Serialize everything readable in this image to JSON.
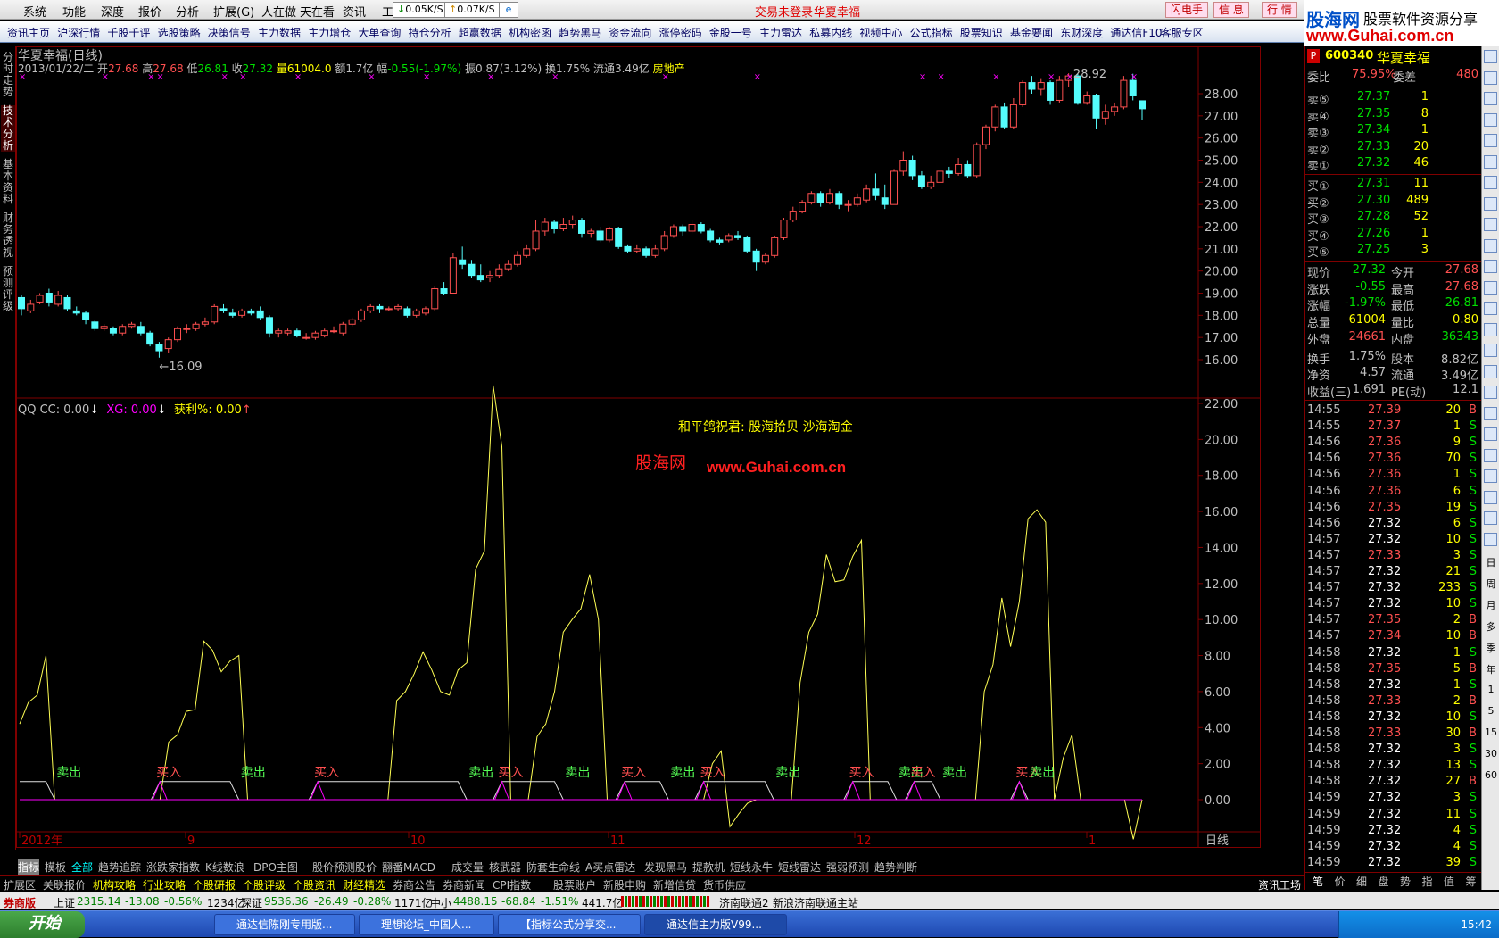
{
  "menu": {
    "items": [
      "系统",
      "功能",
      "深度",
      "报价",
      "分析",
      "扩展(G)",
      "人在做",
      "天在看",
      "资讯",
      "工"
    ],
    "net_down": "0.05K/S",
    "net_up": "0.07K/S",
    "status_login": "交易未登录",
    "stock_name": "华夏幸福",
    "btn_flash": "闪电手",
    "btn_info": "信 息",
    "btn_quote": "行 情"
  },
  "logo": {
    "name": "股海网",
    "slogan": "股票软件资源分享",
    "url": "www.Guhai.com.cn"
  },
  "toolbar": [
    "资讯主页",
    "沪深行情",
    "千股千评",
    "选股策略",
    "决策信号",
    "主力数据",
    "主力增仓",
    "大单查询",
    "持仓分析",
    "超赢数据",
    "机构密函",
    "趋势黑马",
    "资金流向",
    "涨停密码",
    "金股一号",
    "主力雷达",
    "私募内线",
    "视频中心",
    "公式指标",
    "股票知识",
    "基金要闻",
    "东财深度",
    "通达信F10",
    "客服专区"
  ],
  "side_tabs": [
    "分时走势",
    "技术分析",
    "基本资料",
    "财务透视",
    "预测评级"
  ],
  "chart": {
    "title": "华夏幸福(日线)",
    "date": "2013/01/22/二",
    "open_label": "开",
    "open": "27.68",
    "high_label": "高",
    "high": "27.68",
    "low_label": "低",
    "low": "26.81",
    "close_label": "收",
    "close": "27.32",
    "vol_label": "量",
    "vol": "61004.0",
    "amt_label": "额",
    "amt": "1.7亿",
    "chg_label": "幅",
    "chg": "-0.55(-1.97%)",
    "amp_label": "振",
    "amp": "0.87(3.12%)",
    "turn_label": "换",
    "turn": "1.75%",
    "float_label": "流通",
    "float": "3.49亿",
    "sector": "房地产",
    "max_label": "28.92",
    "min_label": "←16.09",
    "price_axis": [
      "28.00",
      "27.00",
      "26.00",
      "25.00",
      "24.00",
      "23.00",
      "22.00",
      "21.00",
      "20.00",
      "19.00",
      "18.00",
      "17.00",
      "16.00"
    ],
    "time_axis": [
      "2012年",
      "9",
      "10",
      "11",
      "12",
      "1"
    ],
    "period": "日线",
    "candles": [
      [
        18.8,
        18.3,
        18.9,
        18.0
      ],
      [
        18.2,
        18.5,
        18.7,
        18.1
      ],
      [
        18.6,
        18.9,
        19.0,
        18.5
      ],
      [
        19.0,
        18.6,
        19.2,
        18.4
      ],
      [
        18.5,
        18.9,
        19.1,
        18.4
      ],
      [
        18.8,
        18.3,
        18.9,
        18.2
      ],
      [
        18.2,
        18.1,
        18.4,
        18.0
      ],
      [
        18.1,
        17.8,
        18.2,
        17.6
      ],
      [
        17.7,
        17.4,
        17.8,
        17.3
      ],
      [
        17.4,
        17.5,
        17.6,
        17.3
      ],
      [
        17.4,
        17.2,
        17.5,
        17.1
      ],
      [
        17.2,
        17.5,
        17.6,
        17.1
      ],
      [
        17.5,
        17.6,
        17.7,
        17.4
      ],
      [
        17.5,
        17.2,
        17.7,
        17.1
      ],
      [
        17.2,
        16.7,
        17.3,
        16.6
      ],
      [
        16.7,
        16.4,
        16.8,
        16.09
      ],
      [
        16.5,
        16.9,
        17.0,
        16.3
      ],
      [
        16.9,
        17.4,
        17.5,
        16.8
      ],
      [
        17.4,
        17.4,
        17.6,
        17.2
      ],
      [
        17.4,
        17.6,
        17.7,
        17.3
      ],
      [
        17.6,
        17.7,
        17.9,
        17.5
      ],
      [
        17.7,
        18.4,
        18.5,
        17.6
      ],
      [
        18.3,
        18.2,
        18.5,
        18.1
      ],
      [
        18.1,
        18.0,
        18.3,
        17.9
      ],
      [
        18.0,
        18.2,
        18.3,
        17.9
      ],
      [
        18.2,
        18.1,
        18.3,
        18.0
      ],
      [
        18.2,
        17.9,
        18.4,
        17.8
      ],
      [
        17.9,
        17.2,
        18.0,
        17.0
      ],
      [
        17.2,
        17.3,
        17.4,
        17.0
      ],
      [
        17.2,
        17.3,
        17.4,
        17.1
      ],
      [
        17.3,
        17.1,
        17.4,
        17.0
      ],
      [
        17.0,
        17.0,
        17.2,
        16.9
      ],
      [
        17.0,
        17.2,
        17.3,
        16.9
      ],
      [
        17.1,
        17.3,
        17.4,
        17.0
      ],
      [
        17.3,
        17.3,
        17.5,
        17.2
      ],
      [
        17.2,
        17.6,
        17.7,
        17.1
      ],
      [
        17.6,
        17.8,
        17.9,
        17.5
      ],
      [
        17.8,
        18.2,
        18.3,
        17.7
      ],
      [
        18.2,
        18.4,
        18.5,
        18.1
      ],
      [
        18.4,
        18.3,
        18.5,
        18.1
      ],
      [
        18.3,
        18.3,
        18.4,
        18.2
      ],
      [
        18.3,
        18.4,
        18.5,
        18.2
      ],
      [
        18.3,
        18.0,
        18.4,
        17.9
      ],
      [
        18.0,
        18.2,
        18.3,
        17.9
      ],
      [
        18.1,
        18.3,
        18.4,
        18.0
      ],
      [
        18.3,
        19.2,
        19.3,
        18.2
      ],
      [
        19.2,
        19.0,
        19.5,
        18.9
      ],
      [
        19.0,
        20.6,
        20.8,
        19.0
      ],
      [
        20.5,
        20.3,
        21.1,
        20.1
      ],
      [
        20.3,
        19.8,
        20.5,
        19.7
      ],
      [
        19.8,
        19.6,
        20.3,
        19.5
      ],
      [
        19.7,
        19.8,
        20.0,
        19.5
      ],
      [
        19.8,
        20.1,
        20.3,
        19.7
      ],
      [
        20.1,
        20.3,
        20.5,
        20.0
      ],
      [
        20.3,
        20.7,
        20.9,
        20.2
      ],
      [
        20.7,
        21.0,
        21.2,
        20.6
      ],
      [
        21.0,
        21.8,
        22.3,
        20.9
      ],
      [
        21.8,
        22.2,
        22.4,
        21.6
      ],
      [
        22.2,
        21.9,
        22.3,
        21.7
      ],
      [
        21.9,
        22.1,
        22.4,
        21.8
      ],
      [
        22.1,
        22.3,
        22.5,
        21.9
      ],
      [
        22.3,
        21.7,
        22.4,
        21.5
      ],
      [
        21.7,
        21.8,
        21.9,
        21.5
      ],
      [
        21.8,
        21.4,
        22.0,
        21.3
      ],
      [
        21.4,
        21.9,
        22.0,
        21.3
      ],
      [
        21.9,
        21.1,
        22.0,
        21.0
      ],
      [
        21.1,
        20.9,
        21.2,
        20.8
      ],
      [
        20.9,
        21.0,
        21.2,
        20.8
      ],
      [
        21.0,
        20.7,
        21.1,
        20.6
      ],
      [
        20.7,
        21.0,
        21.2,
        20.6
      ],
      [
        21.0,
        21.6,
        21.8,
        20.9
      ],
      [
        21.6,
        22.0,
        22.1,
        21.5
      ],
      [
        22.0,
        21.8,
        22.1,
        21.6
      ],
      [
        21.8,
        22.1,
        22.3,
        21.7
      ],
      [
        22.1,
        21.8,
        22.2,
        21.7
      ],
      [
        21.8,
        21.4,
        21.9,
        21.3
      ],
      [
        21.4,
        21.3,
        21.5,
        21.2
      ],
      [
        21.4,
        21.6,
        21.7,
        21.3
      ],
      [
        21.6,
        21.5,
        21.8,
        21.4
      ],
      [
        21.5,
        20.9,
        21.6,
        20.8
      ],
      [
        20.9,
        20.4,
        21.0,
        20.0
      ],
      [
        20.4,
        20.7,
        20.8,
        20.3
      ],
      [
        20.7,
        21.5,
        21.6,
        20.6
      ],
      [
        21.5,
        22.3,
        22.4,
        21.4
      ],
      [
        22.3,
        22.7,
        22.9,
        22.2
      ],
      [
        22.7,
        23.1,
        23.2,
        22.6
      ],
      [
        23.1,
        23.5,
        23.6,
        23.0
      ],
      [
        23.5,
        23.1,
        23.6,
        22.9
      ],
      [
        23.1,
        23.5,
        23.7,
        23.0
      ],
      [
        23.5,
        23.0,
        23.6,
        22.8
      ],
      [
        23.0,
        23.0,
        23.2,
        22.7
      ],
      [
        23.0,
        23.3,
        23.5,
        22.9
      ],
      [
        23.2,
        23.7,
        23.9,
        23.1
      ],
      [
        23.7,
        23.4,
        24.4,
        23.2
      ],
      [
        23.3,
        23.0,
        23.9,
        22.8
      ],
      [
        23.0,
        24.5,
        24.6,
        23.0
      ],
      [
        24.5,
        25.0,
        25.4,
        24.3
      ],
      [
        25.0,
        24.3,
        25.2,
        24.1
      ],
      [
        24.3,
        23.8,
        24.5,
        23.7
      ],
      [
        23.8,
        24.0,
        24.3,
        23.7
      ],
      [
        24.0,
        24.5,
        24.8,
        23.9
      ],
      [
        24.5,
        24.4,
        24.7,
        24.2
      ],
      [
        24.4,
        24.8,
        25.1,
        24.3
      ],
      [
        24.8,
        24.3,
        25.0,
        24.2
      ],
      [
        24.3,
        25.7,
        25.8,
        24.2
      ],
      [
        25.7,
        26.5,
        26.6,
        25.5
      ],
      [
        26.5,
        27.4,
        27.5,
        26.3
      ],
      [
        27.4,
        26.5,
        27.6,
        26.4
      ],
      [
        26.5,
        27.5,
        27.8,
        26.4
      ],
      [
        27.5,
        28.5,
        28.6,
        27.4
      ],
      [
        28.5,
        28.2,
        28.8,
        28.0
      ],
      [
        28.2,
        28.5,
        28.7,
        27.9
      ],
      [
        28.5,
        27.7,
        28.6,
        27.5
      ],
      [
        27.7,
        28.6,
        28.8,
        27.6
      ],
      [
        28.6,
        28.8,
        28.92,
        28.3
      ],
      [
        28.8,
        27.6,
        28.9,
        27.5
      ],
      [
        27.6,
        27.9,
        28.1,
        27.5
      ],
      [
        27.9,
        26.9,
        28.0,
        26.4
      ],
      [
        26.9,
        27.2,
        27.5,
        26.6
      ],
      [
        27.2,
        27.4,
        27.6,
        27.0
      ],
      [
        27.4,
        28.6,
        28.8,
        27.3
      ],
      [
        28.6,
        27.9,
        28.9,
        27.7
      ],
      [
        27.68,
        27.32,
        27.68,
        26.81
      ]
    ]
  },
  "indicator": {
    "legend_qq": "QQ CC: 0.00",
    "legend_xg": "XG: 0.00",
    "legend_profit": "获利%: 0.00",
    "notice1": "和平鸽祝君:  股海拾贝  沙海淘金",
    "watermark_cn": "股海网",
    "watermark_url": "www.Guhai.com.cn",
    "axis": [
      "22.00",
      "20.00",
      "18.00",
      "16.00",
      "14.00",
      "12.00",
      "10.00",
      "8.00",
      "6.00",
      "4.00",
      "2.00",
      "0.00"
    ],
    "buy_label": "买入",
    "sell_label": "卖出",
    "line": [
      4.2,
      5.4,
      5.8,
      8.0,
      0,
      0,
      0,
      0,
      0,
      0,
      0,
      0,
      0,
      0,
      0,
      0,
      0,
      3.2,
      3.6,
      4.9,
      5.0,
      8.8,
      8.3,
      7.1,
      7.7,
      8.0,
      0,
      0,
      0,
      0,
      0,
      0,
      0,
      0,
      0,
      0,
      0,
      0,
      0,
      0,
      0,
      0,
      0,
      5.5,
      6.0,
      7.0,
      8.2,
      7.2,
      6.0,
      5.8,
      7.2,
      7.6,
      12.8,
      13.8,
      23.0,
      19.6,
      0,
      0,
      0,
      3.5,
      4.2,
      6.0,
      9.3,
      10.0,
      10.6,
      12.5,
      10.0,
      0,
      0,
      0,
      0,
      0,
      0,
      0,
      0,
      0,
      0,
      0,
      0,
      2.0,
      2.7,
      -1.5,
      -0.8,
      -0.2,
      0,
      0,
      0,
      0,
      0,
      6.5,
      9.3,
      10.3,
      13.6,
      12.1,
      12.2,
      13.5,
      14.4,
      0,
      0,
      0,
      0,
      0,
      0,
      0,
      0,
      0,
      0,
      0,
      0,
      0,
      6.0,
      7.5,
      11.2,
      8.5,
      11.0,
      15.6,
      16.1,
      15.4,
      0,
      2.3,
      3.6,
      0,
      0,
      0,
      0,
      0,
      0,
      -2.2,
      0.0
    ],
    "signals": [
      {
        "i": 4,
        "t": "sell"
      },
      {
        "i": 16,
        "t": "buy"
      },
      {
        "i": 25,
        "t": "sell"
      },
      {
        "i": 34,
        "t": "buy"
      },
      {
        "i": 51,
        "t": "sell"
      },
      {
        "i": 55,
        "t": "buy"
      },
      {
        "i": 62,
        "t": "sell"
      },
      {
        "i": 69,
        "t": "buy"
      },
      {
        "i": 74,
        "t": "sell"
      },
      {
        "i": 78,
        "t": "buy"
      },
      {
        "i": 86,
        "t": "sell"
      },
      {
        "i": 95,
        "t": "buy"
      },
      {
        "i": 100,
        "t": "sell"
      },
      {
        "i": 102,
        "t": "buy"
      },
      {
        "i": 105,
        "t": "sell"
      },
      {
        "i": 114,
        "t": "buy"
      },
      {
        "i": 115,
        "t": "sell"
      }
    ]
  },
  "bottom_tabs": [
    "指标",
    "模板",
    "全部",
    "趋势追踪",
    "涨跌家指数",
    "K线数浪",
    "DPO主图",
    "股价预测股价",
    "翻番MACD",
    "成交量",
    "核武器",
    "防套生命线",
    "A买点雷达",
    "发现黑马",
    "提款机",
    "短线永牛",
    "短线雷达",
    "强弱预测",
    "趋势判断"
  ],
  "bottom_row2": [
    "扩展区",
    "关联报价",
    "机构攻略",
    "行业攻略",
    "个股研报",
    "个股评级",
    "个股资讯",
    "财经精选",
    "券商公告",
    "券商新闻",
    "CPI指数",
    "股票账户",
    "新股申购",
    "新增信贷",
    "货币供应"
  ],
  "rp": {
    "code": "600340",
    "name": "华夏幸福",
    "webi_label": "委比",
    "webi": "75.95%",
    "weicha_label": "委差",
    "weicha": "480",
    "asks": [
      [
        "卖⑤",
        "27.37",
        "1"
      ],
      [
        "卖④",
        "27.35",
        "8"
      ],
      [
        "卖③",
        "27.34",
        "1"
      ],
      [
        "卖②",
        "27.33",
        "20"
      ],
      [
        "卖①",
        "27.32",
        "46"
      ]
    ],
    "bids": [
      [
        "买①",
        "27.31",
        "11"
      ],
      [
        "买②",
        "27.30",
        "489"
      ],
      [
        "买③",
        "27.28",
        "52"
      ],
      [
        "买④",
        "27.26",
        "1"
      ],
      [
        "买⑤",
        "27.25",
        "3"
      ]
    ],
    "stats": [
      [
        "现价",
        "27.32",
        "今开",
        "27.68"
      ],
      [
        "涨跌",
        "-0.55",
        "最高",
        "27.68"
      ],
      [
        "涨幅",
        "-1.97%",
        "最低",
        "26.81"
      ],
      [
        "总量",
        "61004",
        "量比",
        "0.80"
      ],
      [
        "外盘",
        "24661",
        "内盘",
        "36343"
      ],
      [
        "换手",
        "1.75%",
        "股本",
        "8.82亿"
      ],
      [
        "净资",
        "4.57",
        "流通",
        "3.49亿"
      ],
      [
        "收益(三)",
        "1.691",
        "PE(动)",
        "12.1"
      ]
    ],
    "ticks": [
      [
        "14:55",
        "27.39",
        "20",
        "B"
      ],
      [
        "14:55",
        "27.37",
        "1",
        "S"
      ],
      [
        "14:56",
        "27.36",
        "9",
        "S"
      ],
      [
        "14:56",
        "27.36",
        "70",
        "S"
      ],
      [
        "14:56",
        "27.36",
        "1",
        "S"
      ],
      [
        "14:56",
        "27.36",
        "6",
        "S"
      ],
      [
        "14:56",
        "27.35",
        "19",
        "S"
      ],
      [
        "14:56",
        "27.32",
        "6",
        "S"
      ],
      [
        "14:57",
        "27.32",
        "10",
        "S"
      ],
      [
        "14:57",
        "27.33",
        "3",
        "S"
      ],
      [
        "14:57",
        "27.32",
        "21",
        "S"
      ],
      [
        "14:57",
        "27.32",
        "233",
        "S"
      ],
      [
        "14:57",
        "27.32",
        "10",
        "S"
      ],
      [
        "14:57",
        "27.35",
        "2",
        "B"
      ],
      [
        "14:57",
        "27.34",
        "10",
        "B"
      ],
      [
        "14:58",
        "27.32",
        "1",
        "S"
      ],
      [
        "14:58",
        "27.35",
        "5",
        "B"
      ],
      [
        "14:58",
        "27.32",
        "1",
        "S"
      ],
      [
        "14:58",
        "27.33",
        "2",
        "B"
      ],
      [
        "14:58",
        "27.32",
        "10",
        "S"
      ],
      [
        "14:58",
        "27.33",
        "30",
        "B"
      ],
      [
        "14:58",
        "27.32",
        "3",
        "S"
      ],
      [
        "14:58",
        "27.32",
        "13",
        "S"
      ],
      [
        "14:58",
        "27.32",
        "27",
        "B"
      ],
      [
        "14:59",
        "27.32",
        "3",
        "S"
      ],
      [
        "14:59",
        "27.32",
        "11",
        "S"
      ],
      [
        "14:59",
        "27.32",
        "4",
        "S"
      ],
      [
        "14:59",
        "27.32",
        "4",
        "S"
      ],
      [
        "14:59",
        "27.32",
        "39",
        "S"
      ]
    ],
    "bottom_tabs": [
      "笔",
      "价",
      "细",
      "盘",
      "势",
      "指",
      "值",
      "筹"
    ],
    "work_label": "资讯工场"
  },
  "vtool_icons": [
    "日",
    "周",
    "月",
    "多",
    "季",
    "年",
    "1",
    "5",
    "15",
    "30",
    "60"
  ],
  "status": {
    "broker": "券商版",
    "sh_label": "上证",
    "sh_val": "2315.14",
    "sh_chg": "-13.08",
    "sh_pct": "-0.56%",
    "sh_amt": "1234亿",
    "sz_label": "深证",
    "sz_val": "9536.36",
    "sz_chg": "-26.49",
    "sz_pct": "-0.28%",
    "sz_amt": "1171亿",
    "zx_label": "中小",
    "zx_val": "4488.15",
    "zx_chg": "-68.84",
    "zx_pct": "-1.51%",
    "zx_amt": "441.7亿",
    "server": "济南联通2",
    "server_full": "新浪济南联通主站"
  },
  "taskbar": {
    "start": "开始",
    "tasks": [
      "通达信陈刚专用版...",
      "理想论坛_中国人...",
      "【指标公式分享交...",
      "通达信主力版V99..."
    ],
    "time": "15:42"
  }
}
